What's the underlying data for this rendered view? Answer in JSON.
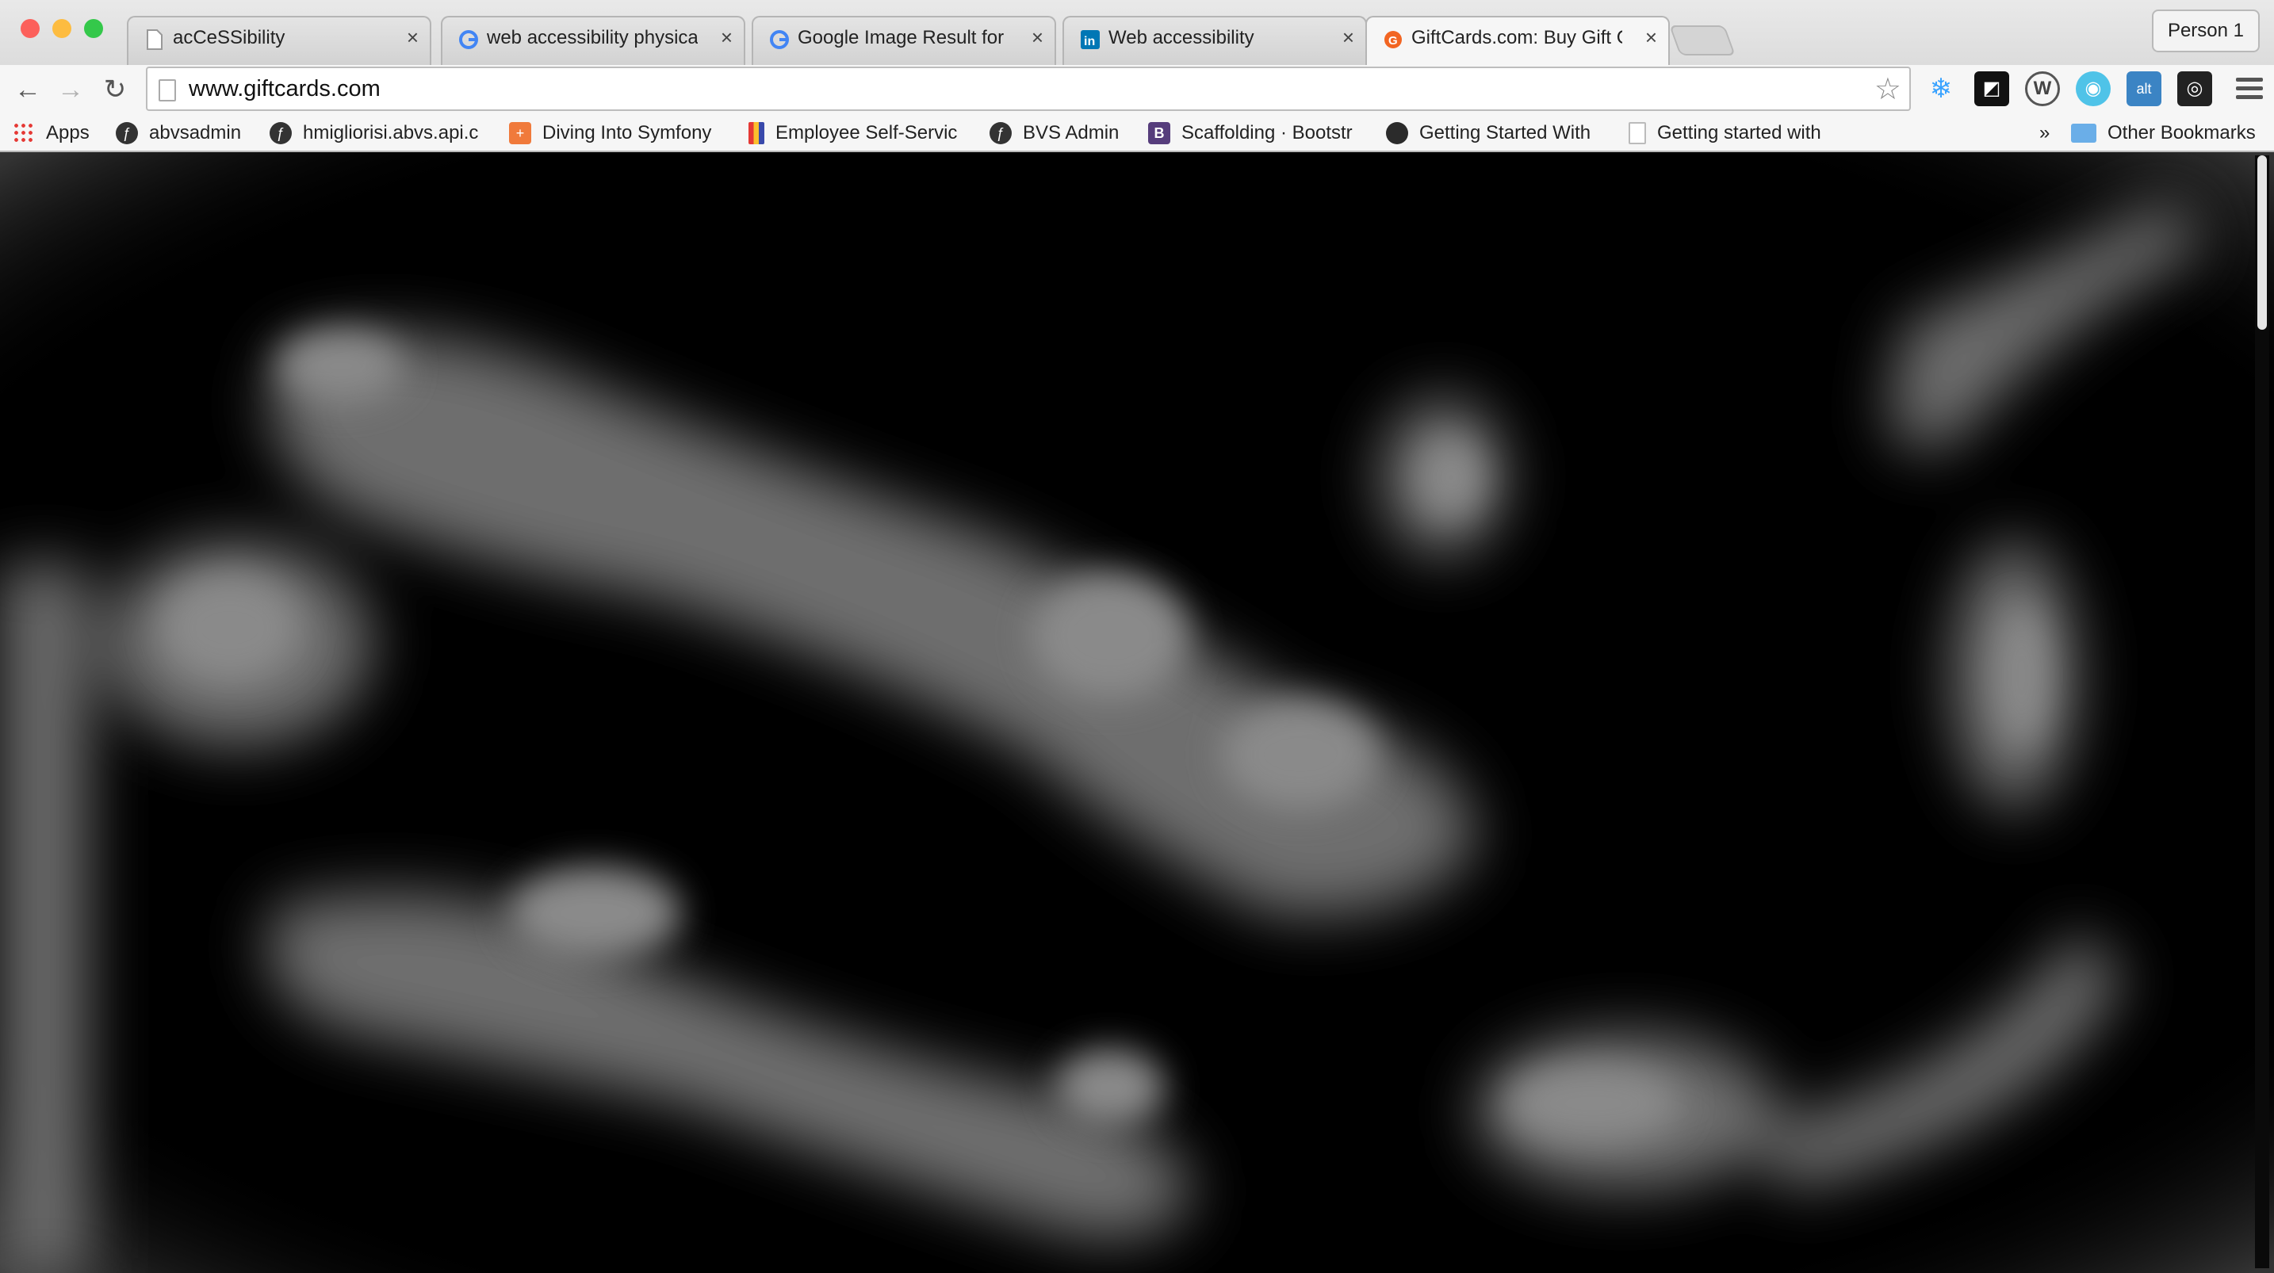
{
  "window": {
    "traffic_lights": [
      "#fc605b",
      "#fdbc40",
      "#34c84a"
    ],
    "profile_button": "Person 1"
  },
  "tabs": [
    {
      "title": "acCeSSibility",
      "icon": "page-icon",
      "active": false
    },
    {
      "title": "web accessibility physical - G",
      "icon": "google-icon",
      "active": false
    },
    {
      "title": "Google Image Result for http:",
      "icon": "google-icon",
      "active": false
    },
    {
      "title": "Web accessibility",
      "icon": "linkedin-icon",
      "active": false
    },
    {
      "title": "GiftCards.com: Buy Gift Car",
      "icon": "giftcards-icon",
      "active": true
    }
  ],
  "toolbar": {
    "back": "back-arrow-icon",
    "forward": "forward-arrow-icon",
    "reload": "reload-icon",
    "url": "www.giftcards.com",
    "bookmark_star": "star-icon",
    "extensions": [
      "snowflake-extension-icon",
      "square-extension-icon",
      "wordpress-extension-icon",
      "circle-extension-icon",
      "alt-extension-icon",
      "camera-extension-icon"
    ],
    "menu": "hamburger-menu-icon"
  },
  "bookmarks": {
    "items": [
      {
        "label": "Apps",
        "icon": "apps-grid-icon"
      },
      {
        "label": "abvsadmin",
        "icon": "symfony-icon"
      },
      {
        "label": "hmigliorisi.abvs.api.c",
        "icon": "symfony-icon"
      },
      {
        "label": "Diving Into Symfony",
        "icon": "plus-square-icon"
      },
      {
        "label": "Employee Self-Servic",
        "icon": "chart-bars-icon"
      },
      {
        "label": "BVS Admin",
        "icon": "symfony-icon"
      },
      {
        "label": "Scaffolding · Bootstr",
        "icon": "bootstrap-icon"
      },
      {
        "label": "Getting Started With",
        "icon": "dark-circle-icon"
      },
      {
        "label": "Getting started with",
        "icon": "page-icon"
      }
    ],
    "overflow": "»",
    "other_bookmarks": "Other Bookmarks"
  },
  "content": {
    "description_type": "heatmap-overlay",
    "colors": {
      "background": "#000000",
      "glow": "#8a8a8a"
    }
  }
}
